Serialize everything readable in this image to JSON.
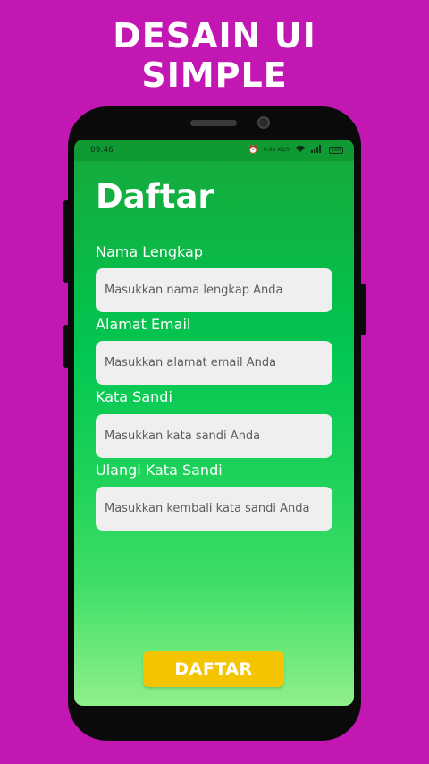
{
  "promo": {
    "line1": "Desain UI",
    "line2": "Simple"
  },
  "status_bar": {
    "time": "09.46",
    "net_speed": "0.08 KB/S",
    "battery": "100"
  },
  "form": {
    "title": "Daftar",
    "fields": [
      {
        "label": "Nama Lengkap",
        "placeholder": "Masukkan nama lengkap Anda"
      },
      {
        "label": "Alamat Email",
        "placeholder": "Masukkan alamat email Anda"
      },
      {
        "label": "Kata Sandi",
        "placeholder": "Masukkan kata sandi Anda"
      },
      {
        "label": "Ulangi Kata Sandi",
        "placeholder": "Masukkan kembali kata sandi Anda"
      }
    ],
    "submit_label": "DAFTAR"
  },
  "colors": {
    "background": "#c217b3",
    "accent": "#f5c400",
    "screen_green": "#02c751"
  }
}
